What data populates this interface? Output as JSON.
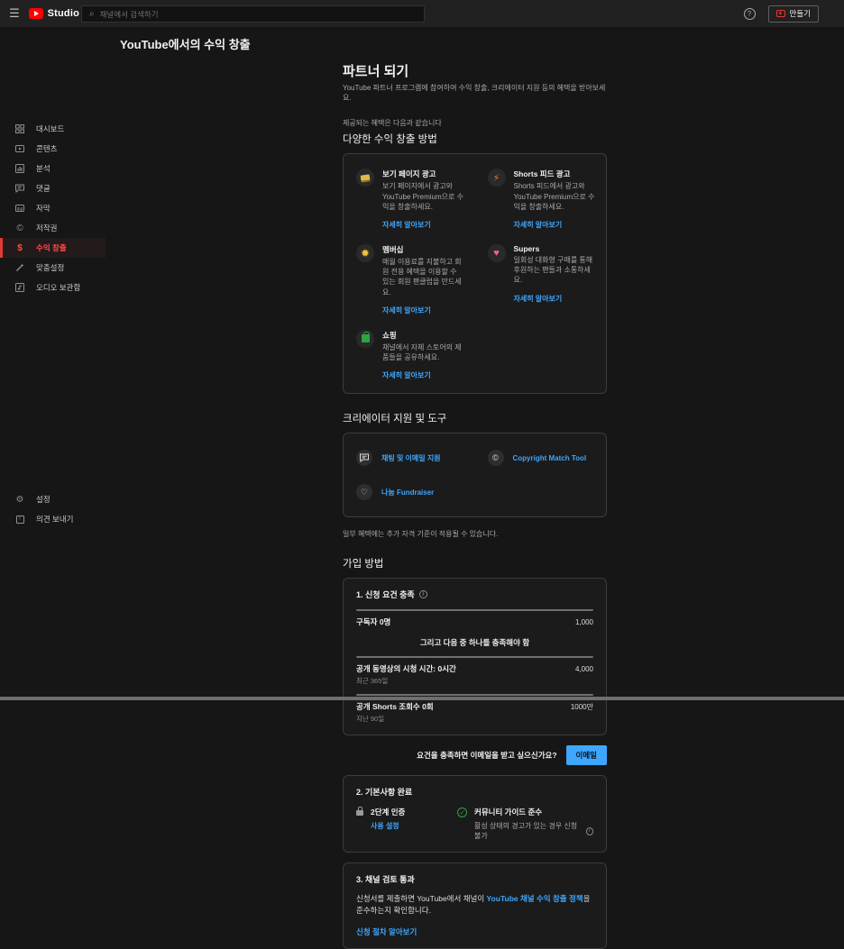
{
  "topbar": {
    "brand": "Studio",
    "search_placeholder": "채널에서 검색하기",
    "help": "?",
    "create_label": "만들기"
  },
  "page": {
    "title": "YouTube에서의 수익 창출"
  },
  "sidebar": {
    "items": [
      {
        "label": "대시보드"
      },
      {
        "label": "콘텐츠"
      },
      {
        "label": "분석"
      },
      {
        "label": "댓글"
      },
      {
        "label": "자막"
      },
      {
        "label": "저작권"
      },
      {
        "label": "수익 창출"
      },
      {
        "label": "맞춤설정"
      },
      {
        "label": "오디오 보관함"
      }
    ],
    "footer_items": [
      {
        "label": "설정"
      },
      {
        "label": "의견 보내기"
      }
    ]
  },
  "partner": {
    "title": "파트너 되기",
    "subtitle": "YouTube 파트너 프로그램에 참여하여 수익 창출, 크리에이터 지원 등의 혜택을 받아보세요.",
    "benefits_intro": "제공되는 혜택은 다음과 같습니다",
    "methods_title": "다양한 수익 창출 방법"
  },
  "benefits": [
    {
      "icon": "watch-page-ads",
      "title": "보기 페이지 광고",
      "desc": "보기 페이지에서 광고와 YouTube Premium으로 수익을 창출하세요.",
      "link": "자세히 알아보기"
    },
    {
      "icon": "shorts-feed-ads",
      "title": "Shorts 피드 광고",
      "desc": "Shorts 피드에서 광고와 YouTube Premium으로 수익을 창출하세요.",
      "link": "자세히 알아보기"
    },
    {
      "icon": "memberships",
      "title": "멤버십",
      "desc": "매월 이용료를 지불하고 회원 전용 혜택을 이용할 수 있는 회원 팬클럽을 만드세요.",
      "link": "자세히 알아보기"
    },
    {
      "icon": "supers",
      "title": "Supers",
      "desc": "일회성 대화형 구매를 통해 후원하는 팬들과 소통하세요.",
      "link": "자세히 알아보기"
    },
    {
      "icon": "shopping",
      "title": "쇼핑",
      "desc": "채널에서 자체 스토어의 제품들을 공유하세요.",
      "link": "자세히 알아보기"
    }
  ],
  "support": {
    "title": "크리에이터 지원 및 도구",
    "items": [
      {
        "icon": "chat",
        "label": "채팅 및 이메일 지원"
      },
      {
        "icon": "copyright",
        "label": "Copyright Match Tool"
      },
      {
        "icon": "fundraiser",
        "label": "나눔 Fundraiser"
      }
    ],
    "note": "일부 혜택에는 추가 자격 기준이 적용될 수 있습니다."
  },
  "join": {
    "title": "가입 방법",
    "step1": {
      "title": "1. 신청 요건 충족",
      "subscribers_label": "구독자 0명",
      "subscribers_target": "1,000",
      "or_text": "그리고 다음 중 하나를 충족해야 함",
      "watch_label": "공개 동영상의 시청 시간: 0시간",
      "watch_target": "4,000",
      "watch_sub": "최근 365일",
      "shorts_label": "공개 Shorts 조회수 0회",
      "shorts_target": "1000만",
      "shorts_sub": "지난 90일"
    },
    "email": {
      "question": "요건을 충족하면 이메일을 받고 싶으신가요?",
      "button": "이메일"
    },
    "step2": {
      "title": "2. 기본사항 완료",
      "twofa_title": "2단계 인증",
      "twofa_link": "사용 설정",
      "guidelines_title": "커뮤니티 가이드 준수",
      "guidelines_sub": "활성 상태의 경고가 있는 경우 신청 불가"
    },
    "step3": {
      "title": "3. 채널 검토 통과",
      "desc_pre": "신청서를 제출하면 YouTube에서 채널이 ",
      "desc_link": "YouTube 채널 수익 창출 정책",
      "desc_post": "을 준수하는지 확인합니다.",
      "link": "신청 절차 알아보기"
    }
  },
  "colors": {
    "accent_red": "#e53935",
    "link_blue": "#3ea6ff",
    "success_green": "#2ba640",
    "topbar_bg": "#212121",
    "page_bg": "#161616",
    "card_border": "#3c3c3c"
  }
}
